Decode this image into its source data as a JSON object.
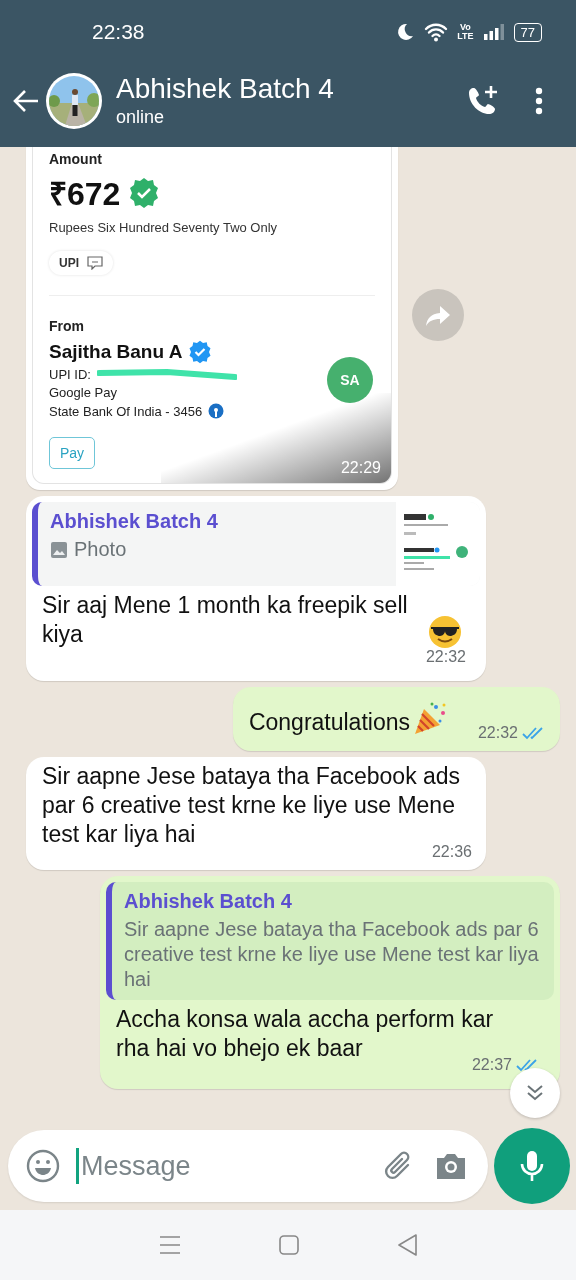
{
  "status_bar": {
    "time": "22:38",
    "network_top": "Vo",
    "network_bottom": "LTE",
    "battery": "77"
  },
  "header": {
    "title": "Abhishek Batch 4",
    "status": "online"
  },
  "messages": [
    {
      "kind": "receipt",
      "outgoing": false,
      "time": "22:29",
      "receipt": {
        "amount_label": "Amount",
        "amount": "₹672",
        "amount_words": "Rupees Six Hundred Seventy Two Only",
        "method": "UPI",
        "from_label": "From",
        "name": "Sajitha Banu A",
        "upi_label": "UPI ID:",
        "app": "Google Pay",
        "bank": "State Bank Of India - 3456",
        "initials": "SA",
        "pay_button": "Pay"
      }
    },
    {
      "kind": "reply",
      "outgoing": false,
      "quote": {
        "author": "Abhishek Batch 4",
        "text": "Photo",
        "photo": true
      },
      "text": "Sir aaj Mene 1 month ka freepik sell kiya",
      "emoji": {
        "kind": "sunglasses"
      },
      "time": "22:32"
    },
    {
      "kind": "text",
      "outgoing": true,
      "text": "Congratulations",
      "emoji": {
        "kind": "party"
      },
      "time": "22:32",
      "read": true
    },
    {
      "kind": "text",
      "outgoing": false,
      "text": "Sir aapne Jese bataya tha Facebook ads par 6 creative test krne ke liye use Mene test kar liya hai",
      "time": "22:36"
    },
    {
      "kind": "reply",
      "outgoing": true,
      "quote": {
        "author": "Abhishek Batch 4",
        "text": "Sir aapne Jese bataya tha Facebook ads par 6 creative test krne ke liye use Mene test kar liya hai",
        "photo": false
      },
      "text": "Accha konsa wala accha perform kar rha hai vo bhejo ek baar",
      "time": "22:37",
      "read": true
    }
  ],
  "composer": {
    "placeholder": "Message"
  }
}
